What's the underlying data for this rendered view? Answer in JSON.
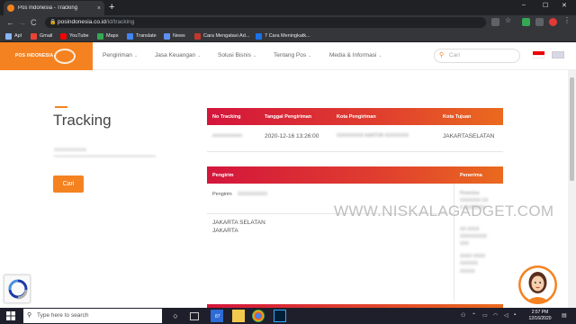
{
  "browser": {
    "tab_title": "Pos Indonesia - Tracking",
    "tab_close": "×",
    "new_tab": "+",
    "window_controls": [
      "–",
      "☐",
      "✕"
    ],
    "url_host": "posindonesia.co.id",
    "url_path": "/id/tracking",
    "nav": {
      "back": "←",
      "forward": "→",
      "reload": "C"
    },
    "bookmarks": [
      {
        "label": "Apl",
        "icon": "apps-grid-icon",
        "color": "#8ab4f8"
      },
      {
        "label": "Gmail",
        "icon": "gmail-icon",
        "color": "#ea4335"
      },
      {
        "label": "YouTube",
        "icon": "youtube-icon",
        "color": "#ff0000"
      },
      {
        "label": "Maps",
        "icon": "maps-icon",
        "color": "#34a853"
      },
      {
        "label": "Translate",
        "icon": "translate-icon",
        "color": "#4285f4"
      },
      {
        "label": "News",
        "icon": "news-icon",
        "color": "#5f8ff0"
      },
      {
        "label": "Cara Mengatasi Ad...",
        "icon": "bookmark-page-icon",
        "color": "#c0392b"
      },
      {
        "label": "7 Cara Meningkatk...",
        "icon": "bookmark-d-icon",
        "color": "#1a73e8"
      }
    ]
  },
  "site": {
    "logo_text": "POS INDONESIA",
    "nav": [
      {
        "label": "Pengiriman"
      },
      {
        "label": "Jasa Keuangan"
      },
      {
        "label": "Solusi Bisnis"
      },
      {
        "label": "Tentang Pos"
      },
      {
        "label": "Media & Informasi"
      }
    ],
    "search_placeholder": "Cari",
    "colors": {
      "brand": "#f58220",
      "accent_red": "#d4153c"
    }
  },
  "page": {
    "title": "Tracking",
    "tracking_input": "xxxxxxxxxxxx",
    "search_button": "Cari"
  },
  "results": {
    "headers": [
      "No Tracking",
      "Tanggal Pengiriman",
      "Kota Pengiriman",
      "Kota Tujuan"
    ],
    "row": {
      "tracking_no": "xxxxxxxxxxxx",
      "date": "2020-12-16 13:26:00",
      "origin_city": "XXXXXXXXX KANTOR XXXXXXXX",
      "dest_city": "JAKARTASELATAN"
    },
    "sender_header": "Pengirim",
    "receiver_header": "Penerima",
    "sender_label": "Pengirim",
    "sender_name": "XXXXXXXXX",
    "sender_address": [
      "JAKARTA SELATAN",
      "JAKARTA"
    ],
    "receiver_lines": [
      "Penerima",
      "XXXXXXX XX",
      "X XXXXXXX",
      "XX XXXX",
      "XXXXXXXXX",
      "XXX",
      "XXXX XXXX",
      "XXXXXX",
      "XXXXX"
    ]
  },
  "watermark": "WWW.NISKALAGADGET.COM",
  "taskbar": {
    "search_placeholder": "Type here to search",
    "time": "2:57 PM",
    "date": "12/16/2020",
    "badge": "87"
  }
}
